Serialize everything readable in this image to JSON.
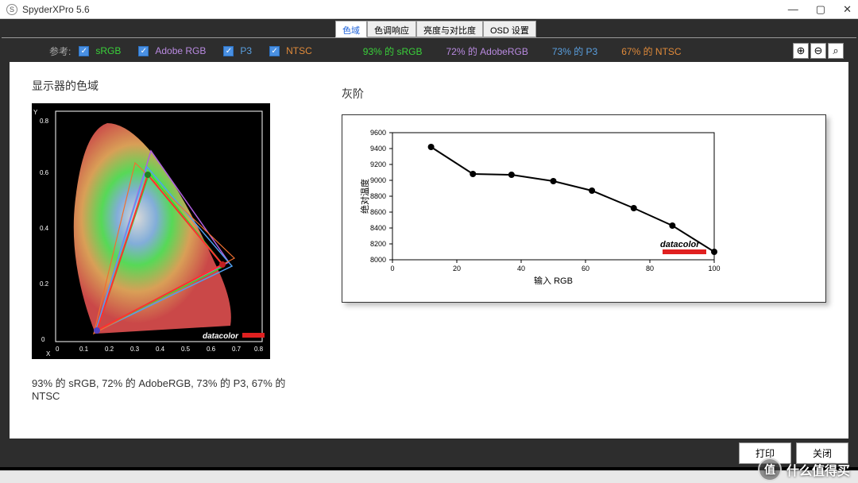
{
  "window": {
    "title": "SpyderXPro 5.6",
    "app_icon_glyph": "S",
    "controls": {
      "min": "—",
      "max": "▢",
      "close": "✕"
    }
  },
  "tabs": [
    {
      "label": "色域",
      "active": true
    },
    {
      "label": "色调响应",
      "active": false
    },
    {
      "label": "亮度与对比度",
      "active": false
    },
    {
      "label": "OSD 设置",
      "active": false
    }
  ],
  "toolbar": {
    "reference_label": "参考:",
    "checks": [
      {
        "label": "sRGB",
        "color": "c-green",
        "checked": true
      },
      {
        "label": "Adobe RGB",
        "color": "c-purple",
        "checked": true
      },
      {
        "label": "P3",
        "color": "c-blue",
        "checked": true
      },
      {
        "label": "NTSC",
        "color": "c-orange",
        "checked": true
      }
    ],
    "metrics": [
      {
        "text": "93% 的 sRGB",
        "color": "c-green"
      },
      {
        "text": "72% 的 AdobeRGB",
        "color": "c-purple"
      },
      {
        "text": "73% 的 P3",
        "color": "c-blue"
      },
      {
        "text": "67% 的 NTSC",
        "color": "c-orange"
      }
    ],
    "zoom": {
      "in": "⊕",
      "out": "⊖",
      "fit": "⌕"
    }
  },
  "gamut": {
    "title": "显示器的色域",
    "caption": "93% 的 sRGB, 72% 的 AdobeRGB, 73% 的 P3, 67% 的 NTSC",
    "brand": "datacolor",
    "x_ticks": [
      "0",
      "0.1",
      "0.2",
      "0.3",
      "0.4",
      "0.5",
      "0.6",
      "0.7",
      "0.8"
    ],
    "y_ticks": [
      "0",
      "0.2",
      "0.4",
      "0.6",
      "0.8"
    ]
  },
  "gray": {
    "title": "灰阶",
    "xlabel": "输入 RGB",
    "ylabel": "绝对温度",
    "brand": "datacolor"
  },
  "bottom_buttons": {
    "print": "打印",
    "close": "关闭"
  },
  "watermark": {
    "badge": "值",
    "text": "什么值得买"
  },
  "chart_data": {
    "type": "line",
    "title": "灰阶",
    "xlabel": "输入 RGB",
    "ylabel": "绝对温度",
    "x": [
      12,
      25,
      37,
      50,
      62,
      75,
      87,
      100
    ],
    "y": [
      9420,
      9080,
      9070,
      8990,
      8870,
      8650,
      8430,
      8100
    ],
    "xlim": [
      0,
      100
    ],
    "ylim": [
      8000,
      9600
    ],
    "x_ticks": [
      0,
      20,
      40,
      60,
      80,
      100
    ],
    "y_ticks": [
      8000,
      8200,
      8400,
      8600,
      8800,
      9000,
      9200,
      9400,
      9600
    ]
  }
}
